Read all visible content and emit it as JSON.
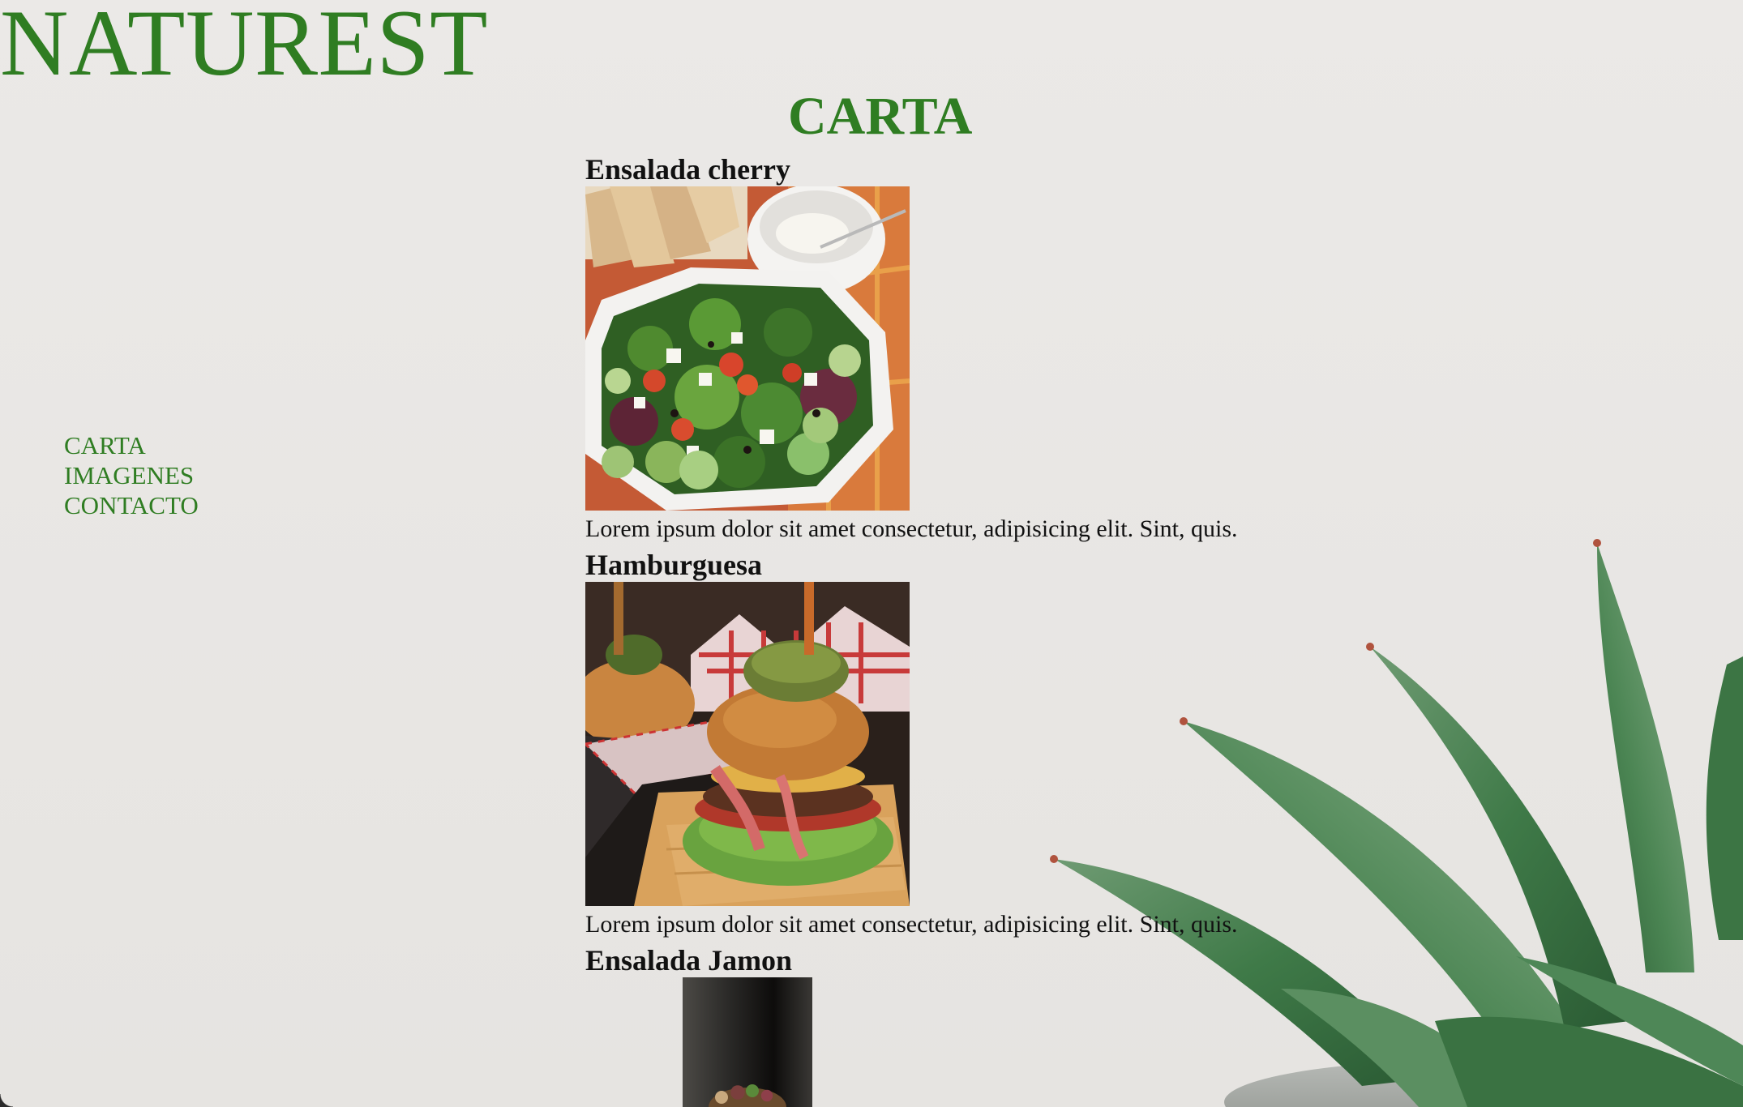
{
  "header": {
    "site_title": "NATUREST"
  },
  "nav": {
    "items": [
      {
        "label": "CARTA"
      },
      {
        "label": "IMAGENES"
      },
      {
        "label": "CONTACTO"
      }
    ]
  },
  "main": {
    "section_title": "CARTA",
    "dishes": [
      {
        "name": "Ensalada cherry",
        "image": "salad-photo",
        "description": "Lorem ipsum dolor sit amet consectetur, adipisicing elit. Sint, quis."
      },
      {
        "name": "Hamburguesa",
        "image": "burger-photo",
        "description": "Lorem ipsum dolor sit amet consectetur, adipisicing elit. Sint, quis."
      },
      {
        "name": "Ensalada Jamon",
        "image": "ham-salad-photo"
      }
    ]
  },
  "background": {
    "image": "succulent-plant-photo"
  },
  "colors": {
    "brand_green": "#2f7d22",
    "background": "#ebe9e7",
    "text": "#111111"
  }
}
